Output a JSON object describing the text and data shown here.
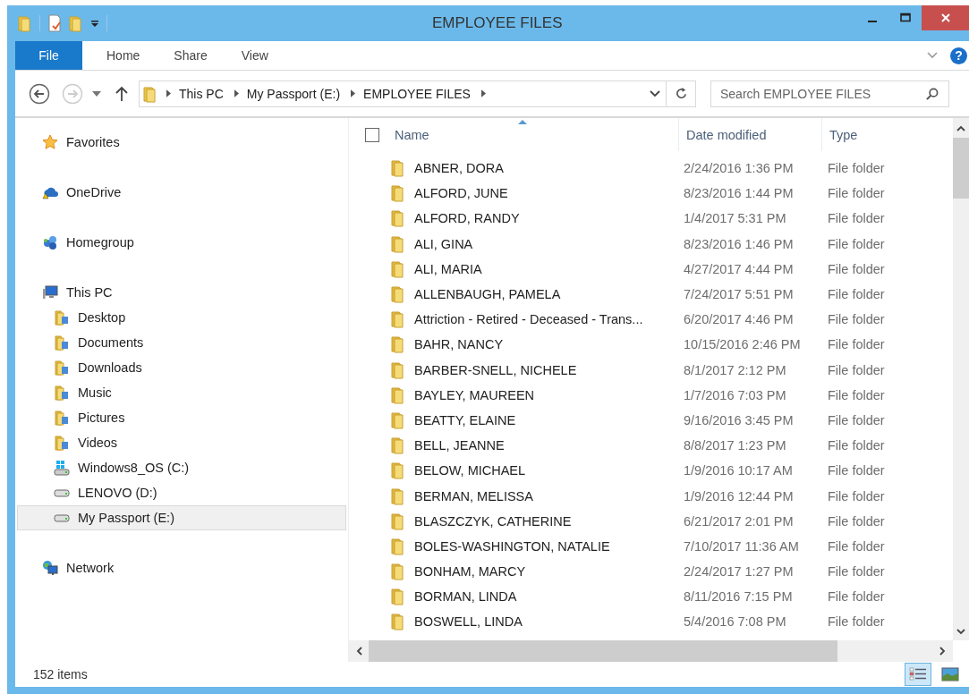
{
  "window": {
    "title": "EMPLOYEE FILES"
  },
  "ribbon": {
    "tabs": [
      {
        "label": "File",
        "selected": true
      },
      {
        "label": "Home",
        "selected": false
      },
      {
        "label": "Share",
        "selected": false
      },
      {
        "label": "View",
        "selected": false
      }
    ],
    "help": "?"
  },
  "address_bar": {
    "crumbs": [
      "This PC",
      "My Passport (E:)",
      "EMPLOYEE FILES"
    ]
  },
  "search": {
    "placeholder": "Search EMPLOYEE FILES"
  },
  "sidebar": {
    "groups": [
      {
        "label": "Favorites",
        "kind": "star",
        "selected": false
      },
      {
        "label": "OneDrive",
        "kind": "cloud",
        "selected": false
      },
      {
        "label": "Homegroup",
        "kind": "homegroup",
        "selected": false
      },
      {
        "label": "This PC",
        "kind": "computer",
        "selected": false,
        "children": [
          {
            "label": "Desktop",
            "kind": "folder",
            "selected": false
          },
          {
            "label": "Documents",
            "kind": "folder",
            "selected": false
          },
          {
            "label": "Downloads",
            "kind": "folder",
            "selected": false
          },
          {
            "label": "Music",
            "kind": "folder",
            "selected": false
          },
          {
            "label": "Pictures",
            "kind": "folder",
            "selected": false
          },
          {
            "label": "Videos",
            "kind": "folder",
            "selected": false
          },
          {
            "label": "Windows8_OS (C:)",
            "kind": "system",
            "selected": false
          },
          {
            "label": "LENOVO (D:)",
            "kind": "drive",
            "selected": false
          },
          {
            "label": "My Passport (E:)",
            "kind": "drive",
            "selected": true
          }
        ]
      },
      {
        "label": "Network",
        "kind": "network",
        "selected": false
      }
    ]
  },
  "table": {
    "select_all": {
      "checked": false
    },
    "columns": [
      {
        "label": "Name",
        "sorted": true
      },
      {
        "label": "Date modified",
        "sorted": false
      },
      {
        "label": "Type",
        "sorted": false
      }
    ],
    "rows": [
      {
        "name": "ABNER, DORA",
        "date": "2/24/2016 1:36 PM",
        "type": "File folder"
      },
      {
        "name": "ALFORD, JUNE",
        "date": "8/23/2016 1:44 PM",
        "type": "File folder"
      },
      {
        "name": "ALFORD, RANDY",
        "date": "1/4/2017 5:31 PM",
        "type": "File folder"
      },
      {
        "name": "ALI, GINA",
        "date": "8/23/2016 1:46 PM",
        "type": "File folder"
      },
      {
        "name": "ALI, MARIA",
        "date": "4/27/2017 4:44 PM",
        "type": "File folder"
      },
      {
        "name": "ALLENBAUGH, PAMELA",
        "date": "7/24/2017 5:51 PM",
        "type": "File folder"
      },
      {
        "name": "Attriction - Retired - Deceased - Trans...",
        "date": "6/20/2017 4:46 PM",
        "type": "File folder"
      },
      {
        "name": "BAHR, NANCY",
        "date": "10/15/2016 2:46 PM",
        "type": "File folder"
      },
      {
        "name": "BARBER-SNELL, NICHELE",
        "date": "8/1/2017 2:12 PM",
        "type": "File folder"
      },
      {
        "name": "BAYLEY, MAUREEN",
        "date": "1/7/2016 7:03 PM",
        "type": "File folder"
      },
      {
        "name": "BEATTY, ELAINE",
        "date": "9/16/2016 3:45 PM",
        "type": "File folder"
      },
      {
        "name": "BELL, JEANNE",
        "date": "8/8/2017 1:23 PM",
        "type": "File folder"
      },
      {
        "name": "BELOW, MICHAEL",
        "date": "1/9/2016 10:17 AM",
        "type": "File folder"
      },
      {
        "name": "BERMAN, MELISSA",
        "date": "1/9/2016 12:44 PM",
        "type": "File folder"
      },
      {
        "name": "BLASZCZYK, CATHERINE",
        "date": "6/21/2017 2:01 PM",
        "type": "File folder"
      },
      {
        "name": "BOLES-WASHINGTON, NATALIE",
        "date": "7/10/2017 11:36 AM",
        "type": "File folder"
      },
      {
        "name": "BONHAM, MARCY",
        "date": "2/24/2017 1:27 PM",
        "type": "File folder"
      },
      {
        "name": "BORMAN, LINDA",
        "date": "8/11/2016 7:15 PM",
        "type": "File folder"
      },
      {
        "name": "BOSWELL, LINDA",
        "date": "5/4/2016 7:08 PM",
        "type": "File folder"
      }
    ]
  },
  "status_bar": {
    "count": "152 items",
    "views": [
      {
        "kind": "details",
        "selected": true
      },
      {
        "kind": "tiles",
        "selected": false
      }
    ]
  }
}
